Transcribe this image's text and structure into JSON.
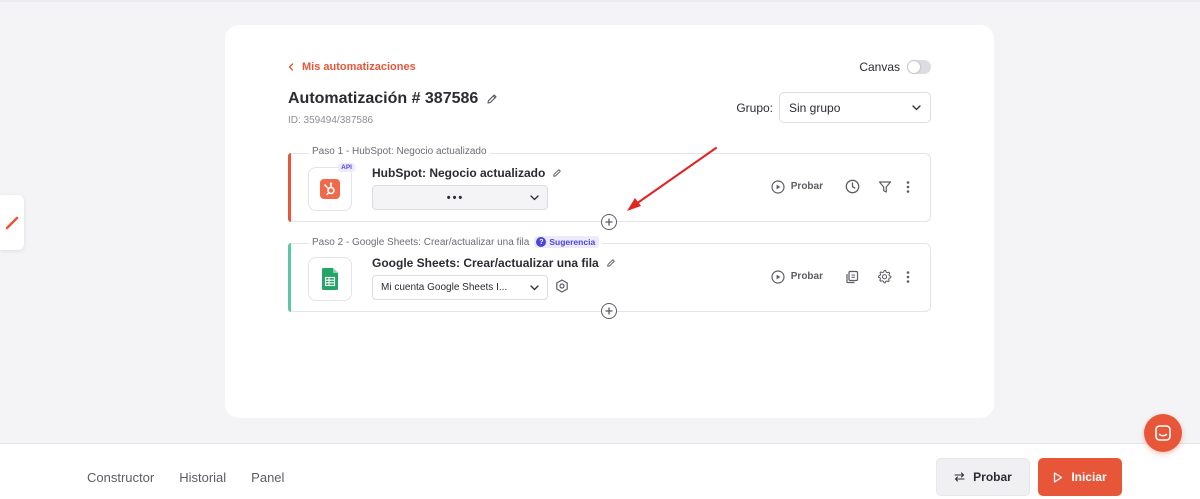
{
  "header": {
    "back_label": "Mis automatizaciones",
    "canvas_label": "Canvas",
    "title": "Automatización # 387586",
    "id_text": "ID: 359494/387586",
    "group_label": "Grupo:",
    "group_value": "Sin grupo"
  },
  "steps": [
    {
      "label": "Paso 1 - HubSpot: Negocio actualizado",
      "name": "HubSpot: Negocio actualizado",
      "account_value": "•••",
      "badge": "API",
      "test_label": "Probar",
      "accent_color": "#e8563a"
    },
    {
      "label": "Paso 2 - Google Sheets: Crear/actualizar una fila",
      "suggestion": "Sugerencia",
      "name": "Google Sheets: Crear/actualizar una fila",
      "account_value": "Mi cuenta Google Sheets I...",
      "test_label": "Probar",
      "accent_color": "#5cc7a0"
    }
  ],
  "bottom": {
    "tabs": [
      "Constructor",
      "Historial",
      "Panel"
    ],
    "probar_label": "Probar",
    "iniciar_label": "Iniciar"
  },
  "colors": {
    "brand": "#e8563a",
    "hubspot": "#f0694a",
    "sheets": "#23a566",
    "suggestion": "#4c45d6",
    "annotation_arrow": "#e02424"
  },
  "icons": {
    "side_tab": "brand-logo-icon",
    "chat": "chat-icon"
  }
}
